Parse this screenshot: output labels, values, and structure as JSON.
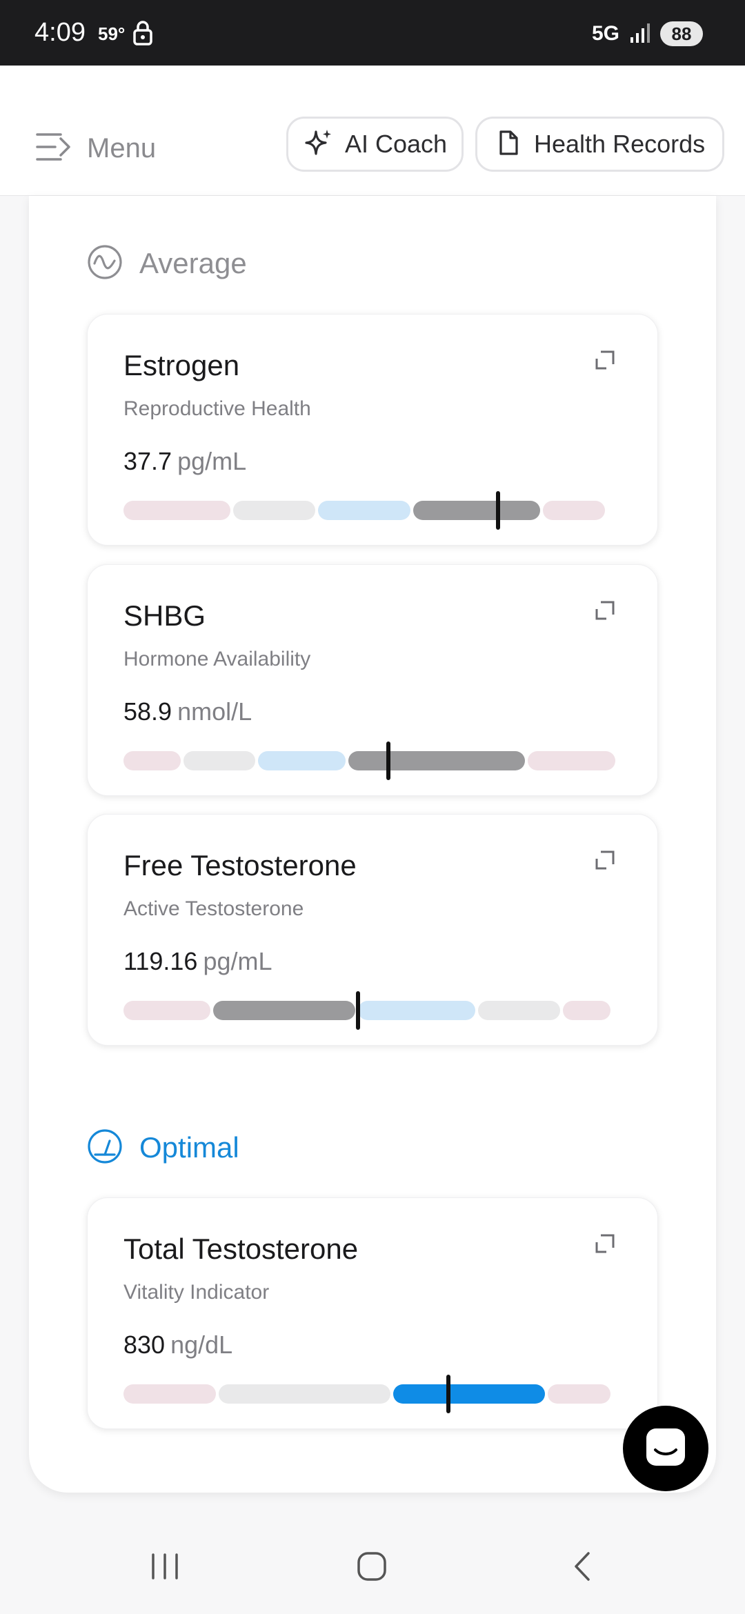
{
  "status_bar": {
    "time": "4:09",
    "temperature": "59°",
    "network": "5G",
    "battery": "88"
  },
  "app_bar": {
    "menu_label": "Menu",
    "ai_coach_label": "AI Coach",
    "health_records_label": "Health Records"
  },
  "sections": {
    "average_label": "Average",
    "optimal_label": "Optimal"
  },
  "cards": [
    {
      "title": "Estrogen",
      "subtitle": "Reproductive Health",
      "value": "37.7",
      "unit": "pg/mL",
      "marker_position": 0.75,
      "segments": [
        {
          "color": "#f0e1e6",
          "width": 0.22
        },
        {
          "color": "#e9e9ea",
          "width": 0.17
        },
        {
          "color": "#cfe6f8",
          "width": 0.19
        },
        {
          "color": "#9a9a9c",
          "width": 0.26
        },
        {
          "color": "#f0e1e6",
          "width": 0.13
        }
      ]
    },
    {
      "title": "SHBG",
      "subtitle": "Hormone Availability",
      "value": "58.9",
      "unit": "nmol/L",
      "marker_position": 0.53,
      "segments": [
        {
          "color": "#f0e1e6",
          "width": 0.12
        },
        {
          "color": "#e9e9ea",
          "width": 0.15
        },
        {
          "color": "#cfe6f8",
          "width": 0.18
        },
        {
          "color": "#9a9a9c",
          "width": 0.36
        },
        {
          "color": "#f0e1e6",
          "width": 0.18
        }
      ]
    },
    {
      "title": "Free Testosterone",
      "subtitle": "Active Testosterone",
      "value": "119.16",
      "unit": "pg/mL",
      "marker_position": 0.47,
      "segments": [
        {
          "color": "#f0e1e6",
          "width": 0.18
        },
        {
          "color": "#9a9a9c",
          "width": 0.29
        },
        {
          "color": "#cfe6f8",
          "width": 0.24
        },
        {
          "color": "#e9e9ea",
          "width": 0.17
        },
        {
          "color": "#f0e1e6",
          "width": 0.1
        }
      ]
    },
    {
      "title": "Total Testosterone",
      "subtitle": "Vitality Indicator",
      "value": "830",
      "unit": "ng/dL",
      "marker_position": 0.65,
      "segments": [
        {
          "color": "#f0e1e6",
          "width": 0.19
        },
        {
          "color": "#e9e9ea",
          "width": 0.35
        },
        {
          "color": "#0f8ce6",
          "width": 0.31
        },
        {
          "color": "#f0e1e6",
          "width": 0.13
        }
      ]
    }
  ]
}
